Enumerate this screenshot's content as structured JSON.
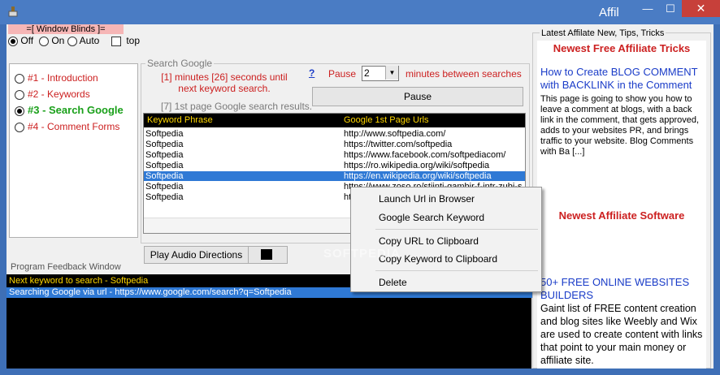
{
  "window": {
    "title": "Affil",
    "minimize": "—",
    "maximize": "☐",
    "close": "✕"
  },
  "blinds": {
    "label": "=[ Window Blinds ]=",
    "options": [
      {
        "label": "Off",
        "checked": true
      },
      {
        "label": "On",
        "checked": false
      },
      {
        "label": "Auto",
        "checked": false
      }
    ],
    "top_label": "top"
  },
  "nav": {
    "items": [
      {
        "label": "#1 - Introduction",
        "active": false
      },
      {
        "label": "#2 - Keywords",
        "active": false
      },
      {
        "label": "#3 - Search Google",
        "active": true
      },
      {
        "label": "#4 - Comment Forms",
        "active": false
      }
    ]
  },
  "search": {
    "legend": "Search Google",
    "timer_text": "[1] minutes [26] seconds until next keyword search.",
    "help": "?",
    "pause_label": "Pause",
    "pause_value": "2",
    "between_label": "minutes between searches",
    "pause_button": "Pause",
    "results_label": "[7] 1st page Google search results."
  },
  "table": {
    "headers": [
      "Keyword Phrase",
      "Google 1st Page Urls"
    ],
    "rows": [
      {
        "keyword": "Softpedia",
        "url": "http://www.softpedia.com/"
      },
      {
        "keyword": "Softpedia",
        "url": "https://twitter.com/softpedia"
      },
      {
        "keyword": "Softpedia",
        "url": "https://www.facebook.com/softpediacom/"
      },
      {
        "keyword": "Softpedia",
        "url": "https://ro.wikipedia.org/wiki/softpedia"
      },
      {
        "keyword": "Softpedia",
        "url": "https://en.wikipedia.org/wiki/softpedia"
      },
      {
        "keyword": "Softpedia",
        "url": "https://www.zoso.ro/stiinti-gambir-f-intr-zubi-si-softpedia"
      },
      {
        "keyword": "Softpedia",
        "url": "https://www.softpedia.com/get/..."
      }
    ],
    "selected_index": 4
  },
  "audio": {
    "button": "Play Audio Directions"
  },
  "feedback": {
    "label": "Program Feedback Window",
    "lines": [
      "Next keyword to search - Softpedia",
      "Searching Google via url - https://www.google.com/search?q=Softpedia"
    ]
  },
  "right_panel": {
    "legend": "Latest Affilate New, Tips, Tricks",
    "tips_heading": "Newest Free Affiliate Tricks",
    "tips_link": "How to Create BLOG COMMENT with BACKLINK in the Comment",
    "tips_body": "This page is going to show you how to leave a comment at blogs, with a back link in the comment, that gets approved, adds to your websites PR, and brings traffic to your website. Blog Comments with Ba [...]",
    "software_heading": "Newest Affiliate Software",
    "software_link": "50+ FREE ONLINE WEBSITES BUILDERS",
    "software_body": "Gaint list of FREE content creation and blog sites like Weebly and Wix are used to create content with links that point to your main money or affiliate site."
  },
  "context_menu": {
    "items": [
      "Launch Url in Browser",
      "Google Search Keyword",
      "Copy URL to Clipboard",
      "Copy Keyword to Clipboard",
      "Delete"
    ]
  },
  "watermark": "SOFTPEDIA"
}
